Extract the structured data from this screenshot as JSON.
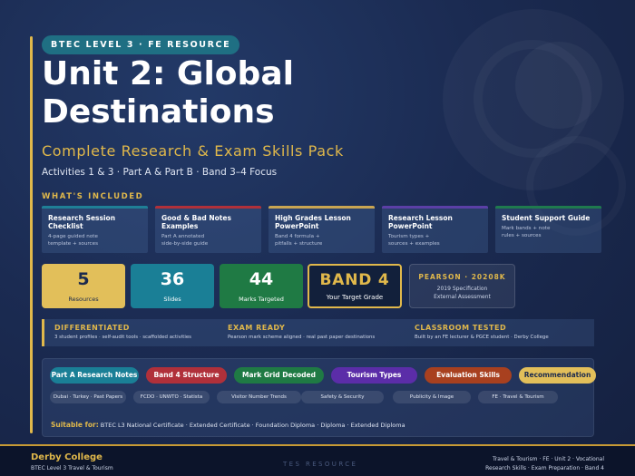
{
  "header": {
    "badge": "BTEC LEVEL 3 · FE RESOURCE",
    "title": "Unit 2: Global Destinations",
    "subtitle": "Complete Research & Exam Skills Pack",
    "focus": "Activities 1 & 3 · Part A & Part B · Band 3–4 Focus"
  },
  "included": {
    "label": "WHAT'S INCLUDED",
    "cards": [
      {
        "title": "Research Session Checklist",
        "desc1": "4-page guided note",
        "desc2": "template + sources",
        "color": "#1f7f96"
      },
      {
        "title": "Good & Bad Notes Examples",
        "desc1": "Part A annotated",
        "desc2": "side-by-side guide",
        "color": "#b0303a"
      },
      {
        "title": "High Grades Lesson PowerPoint",
        "desc1": "Band 4 formula +",
        "desc2": "pitfalls + structure",
        "color": "#c9a552"
      },
      {
        "title": "Research Lesson PowerPoint",
        "desc1": "Tourism types +",
        "desc2": "sources + examples",
        "color": "#5b3fa6"
      },
      {
        "title": "Student Support Guide",
        "desc1": "Mark bands + note",
        "desc2": "rules + sources",
        "color": "#1f7a4e"
      }
    ]
  },
  "stats": [
    {
      "num": "5",
      "label": "Resources",
      "bg": "#e2bf5a",
      "fg": "#1b2a4e"
    },
    {
      "num": "36",
      "label": "Slides",
      "bg": "#1a7f96",
      "fg": "#ffffff"
    },
    {
      "num": "44",
      "label": "Marks Targeted",
      "bg": "#1f7a44",
      "fg": "#ffffff"
    }
  ],
  "band": {
    "num": "BAND 4",
    "label": "Your Target Grade"
  },
  "pearson": {
    "title": "PEARSON · 20208K",
    "line1": "2019 Specification",
    "line2": "External Assessment"
  },
  "features": [
    {
      "title": "DIFFERENTIATED",
      "desc": "3 student profiles · self-audit tools · scaffolded activities"
    },
    {
      "title": "EXAM READY",
      "desc": "Pearson mark scheme aligned · real past paper destinations"
    },
    {
      "title": "CLASSROOM TESTED",
      "desc": "Built by an FE lecturer & PGCE student · Derby College"
    }
  ],
  "tags": [
    {
      "label": "Part A Research Notes",
      "bg": "#1a7f96",
      "fg": "#ffffff"
    },
    {
      "label": "Band 4 Structure",
      "bg": "#b0303a",
      "fg": "#ffffff"
    },
    {
      "label": "Mark Grid Decoded",
      "bg": "#1f7a44",
      "fg": "#ffffff"
    },
    {
      "label": "Tourism Types",
      "bg": "#5b2da8",
      "fg": "#ffffff"
    },
    {
      "label": "Evaluation Skills",
      "bg": "#a8401f",
      "fg": "#ffffff"
    },
    {
      "label": "Recommendation",
      "bg": "#e2bf5a",
      "fg": "#1b2a4e"
    }
  ],
  "subtags": [
    "Dubai · Turkey · Past Papers",
    "FCDO · UNWTO · Statista",
    "Visitor Number Trends",
    "Safety & Security",
    "Publicity & Image",
    "FE · Travel & Tourism"
  ],
  "suitable": {
    "label": "Suitable for:",
    "text": "BTEC L3 National Certificate · Extended Certificate · Foundation Diploma · Diploma · Extended Diploma"
  },
  "footer": {
    "college": "Derby College",
    "course": "BTEC Level 3 Travel & Tourism",
    "center": "TES RESOURCE",
    "right1": "Travel & Tourism · FE · Unit 2 · Vocational",
    "right2": "Research Skills · Exam Preparation · Band 4"
  }
}
